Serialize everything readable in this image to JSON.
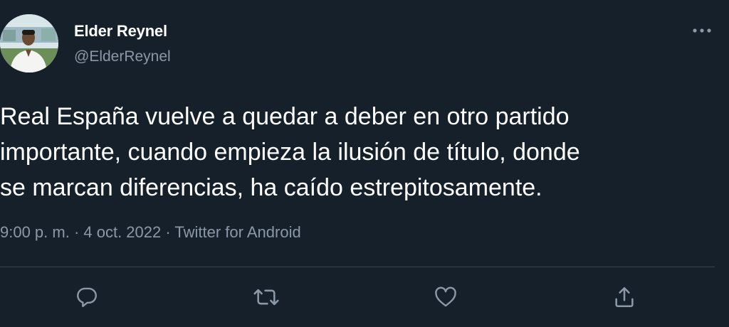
{
  "tweet": {
    "author": {
      "display_name": "Elder Reynel",
      "handle": "@ElderReynel"
    },
    "text": "Real España vuelve a quedar a deber en otro partido\nimportante, cuando empieza la ilusión de título, donde\nse marcan diferencias, ha caído estrepitosamente.",
    "timestamp": "9:00 p. m. · 4 oct. 2022",
    "separator": " · ",
    "source": "Twitter for Android",
    "actions": [
      "reply-icon",
      "retweet-icon",
      "like-icon",
      "share-icon"
    ],
    "more_icon": "more-icon"
  },
  "colors": {
    "background": "#15202b",
    "text": "#ffffff",
    "secondary_text": "#8b98a5",
    "divider": "#38444d"
  }
}
